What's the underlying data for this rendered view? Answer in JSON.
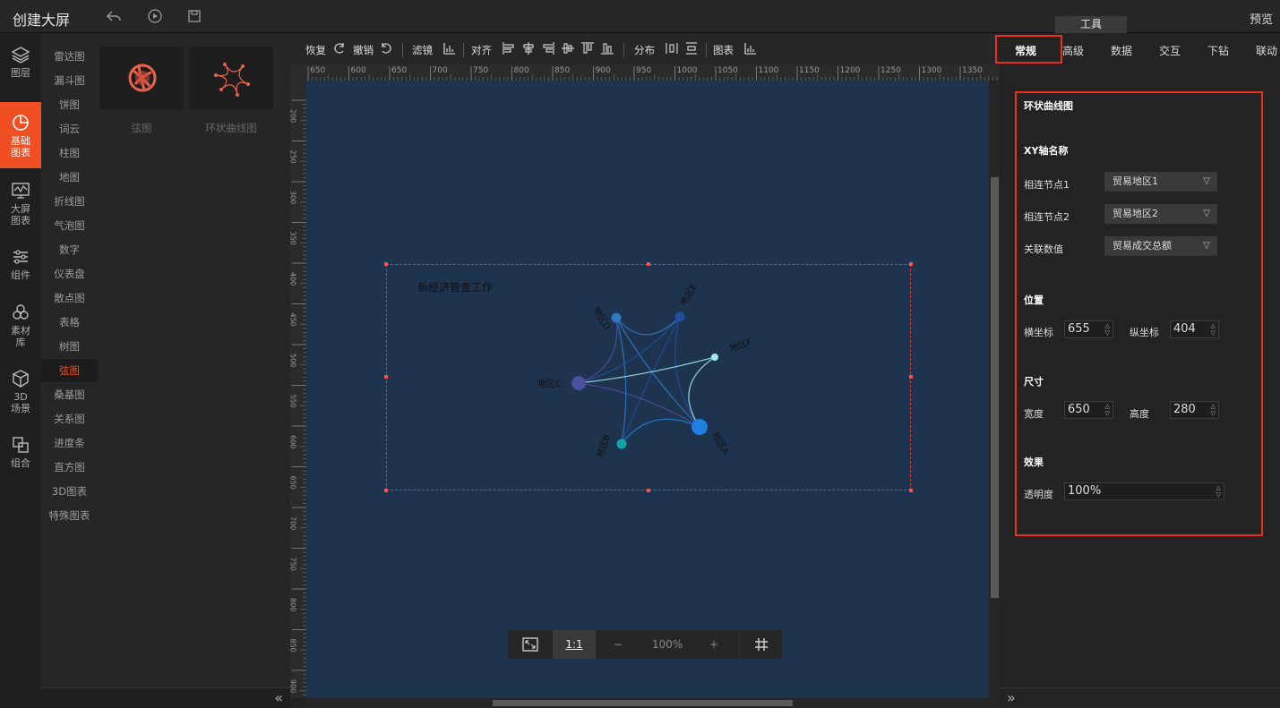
{
  "app": {
    "title": "创建大屏",
    "preview": "预览",
    "tool_tab": "工具"
  },
  "left_rail": [
    {
      "label": "图层",
      "icon": "layers-icon"
    },
    {
      "label": "基础图表",
      "icon": "pie-chart-icon",
      "active": true
    },
    {
      "label": "大屏图表",
      "icon": "monitor-chart-icon"
    },
    {
      "label": "组件",
      "icon": "sliders-icon"
    },
    {
      "label": "素材库",
      "icon": "hexagons-icon"
    },
    {
      "label": "3D场景",
      "icon": "cube-icon"
    },
    {
      "label": "组合",
      "icon": "combine-icon"
    }
  ],
  "categories": [
    "雷达图",
    "漏斗图",
    "饼图",
    "词云",
    "柱图",
    "地图",
    "折线图",
    "气泡图",
    "数字",
    "仪表盘",
    "散点图",
    "表格",
    "树图",
    "弦图",
    "桑基图",
    "关系图",
    "进度条",
    "直方图",
    "3D图表",
    "特殊图表"
  ],
  "active_category": "弦图",
  "thumbnails": [
    {
      "label": "弦图"
    },
    {
      "label": "环状曲线图"
    }
  ],
  "toolbar": {
    "redo": "恢复",
    "undo": "撤销",
    "filter": "滤镜",
    "align": "对齐",
    "distribute": "分布",
    "chart": "图表"
  },
  "ruler": {
    "h_ticks": [
      "650",
      "600",
      "650",
      "700",
      "750",
      "800",
      "850",
      "900",
      "950",
      "1000",
      "1050",
      "1100",
      "1150",
      "1200",
      "1250",
      "1300",
      "1350",
      "140"
    ],
    "v_ticks": [
      "200",
      "250",
      "300",
      "350",
      "400",
      "450",
      "500",
      "550",
      "600",
      "650",
      "700",
      "750",
      "800",
      "850",
      "900"
    ]
  },
  "canvas": {
    "chart_title": "新经济普查工作",
    "nodes": [
      {
        "name": "地区D",
        "color": "#2f78c2"
      },
      {
        "name": "地区E",
        "color": "#1f4f9a"
      },
      {
        "name": "地区F",
        "color": "#9fe8f5"
      },
      {
        "name": "地区C",
        "color": "#4a4f9e"
      },
      {
        "name": "地区A",
        "color": "#1e7fe0"
      },
      {
        "name": "地区B",
        "color": "#14a3a8"
      }
    ]
  },
  "zoombar": {
    "fit_icon": "fit-screen-icon",
    "actual": "1:1",
    "minus": "−",
    "zoom": "100%",
    "plus": "+",
    "grid_icon": "grid-icon"
  },
  "right_panel": {
    "tabs": [
      "常规",
      "高级",
      "数据",
      "交互",
      "下钻",
      "联动"
    ],
    "active_tab": "常规",
    "section_title": "环状曲线图",
    "xy_title": "XY轴名称",
    "fields": [
      {
        "label": "相连节点1",
        "value": "贸易地区1"
      },
      {
        "label": "相连节点2",
        "value": "贸易地区2"
      },
      {
        "label": "关联数值",
        "value": "贸易成交总额"
      }
    ],
    "position_title": "位置",
    "x_label": "横坐标",
    "x_value": "655",
    "y_label": "纵坐标",
    "y_value": "404",
    "size_title": "尺寸",
    "w_label": "宽度",
    "w_value": "650",
    "h_label": "高度",
    "h_value": "280",
    "effect_title": "效果",
    "opacity_label": "透明度",
    "opacity_value": "100%"
  },
  "colors": {
    "accent": "#f04e23",
    "canvas": "#1e334d",
    "highlight": "#e8321e"
  }
}
